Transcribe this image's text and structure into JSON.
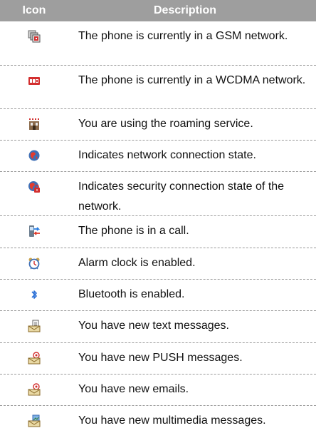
{
  "header": {
    "icon_label": "Icon",
    "description_label": "Description"
  },
  "rows": [
    {
      "icon": "gsm-network-icon",
      "description": "The phone is currently in a GSM network."
    },
    {
      "icon": "wcdma-network-icon",
      "description": "The phone is currently in a WCDMA network."
    },
    {
      "icon": "roaming-icon",
      "description": "You are using the roaming service."
    },
    {
      "icon": "network-connection-icon",
      "description": "Indicates network connection state."
    },
    {
      "icon": "secure-connection-icon",
      "description": "Indicates security connection state of the network."
    },
    {
      "icon": "in-call-icon",
      "description": "The phone is in a call."
    },
    {
      "icon": "alarm-clock-icon",
      "description": "Alarm clock is enabled."
    },
    {
      "icon": "bluetooth-icon",
      "description": "Bluetooth is enabled."
    },
    {
      "icon": "text-message-icon",
      "description": "You have new text messages."
    },
    {
      "icon": "push-message-icon",
      "description": "You have new PUSH messages."
    },
    {
      "icon": "email-icon",
      "description": "You have new emails."
    },
    {
      "icon": "multimedia-message-icon",
      "description": "You have new multimedia messages."
    }
  ]
}
